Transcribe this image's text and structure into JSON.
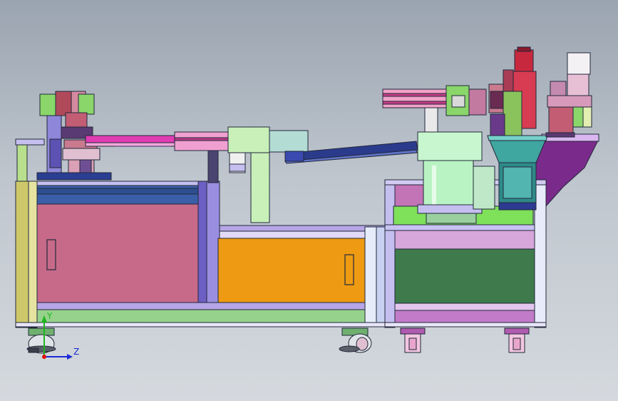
{
  "view": {
    "type": "cad-assembly-viewport",
    "background_top": "#9aa4b0",
    "background_bottom": "#d5d9de"
  },
  "triad": {
    "y_label": "Y",
    "z_label": "Z",
    "y_color": "#1fb51f",
    "z_color": "#1a2bd6",
    "origin_color": "#e01010"
  },
  "palette": {
    "frame_outline": "#22283a",
    "left_cabinet_panel": "#c76a8a",
    "middle_cabinet_panel": "#ee9a12",
    "right_cabinet_panel": "#3e7a4c",
    "frame_lavender": "#c5bff0",
    "frame_green": "#96d28c",
    "feeder_bowl": "#3fa6a0",
    "vibratory_base": "#b9f3c3",
    "chute_blue": "#2b3b8c",
    "magenta": "#e0308a",
    "purple_deck": "#7a2a8a",
    "red_cylinder": "#c8283e"
  }
}
